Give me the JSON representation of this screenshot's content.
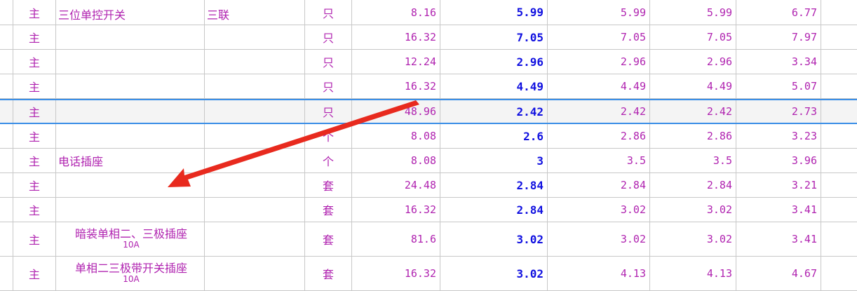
{
  "rows": [
    {
      "type": "主",
      "name": "三位单控开关",
      "name_sub": "",
      "spec": "三联",
      "unit": "只",
      "qty": "8.16",
      "price_bold": "5.99",
      "p2": "5.99",
      "p3": "5.99",
      "p4": "6.77"
    },
    {
      "type": "主",
      "name": "",
      "name_sub": "",
      "spec": "",
      "unit": "只",
      "qty": "16.32",
      "price_bold": "7.05",
      "p2": "7.05",
      "p3": "7.05",
      "p4": "7.97"
    },
    {
      "type": "主",
      "name": "",
      "name_sub": "",
      "spec": "",
      "unit": "只",
      "qty": "12.24",
      "price_bold": "2.96",
      "p2": "2.96",
      "p3": "2.96",
      "p4": "3.34"
    },
    {
      "type": "主",
      "name": "",
      "name_sub": "",
      "spec": "",
      "unit": "只",
      "qty": "16.32",
      "price_bold": "4.49",
      "p2": "4.49",
      "p3": "4.49",
      "p4": "5.07"
    },
    {
      "type": "主",
      "name": "",
      "name_sub": "",
      "spec": "",
      "unit": "只",
      "qty": "48.96",
      "price_bold": "2.42",
      "p2": "2.42",
      "p3": "2.42",
      "p4": "2.73"
    },
    {
      "type": "主",
      "name": "",
      "name_sub": "",
      "spec": "",
      "unit": "个",
      "qty": "8.08",
      "price_bold": "2.6",
      "p2": "2.86",
      "p3": "2.86",
      "p4": "3.23"
    },
    {
      "type": "主",
      "name": "电话插座",
      "name_sub": "",
      "spec": "",
      "unit": "个",
      "qty": "8.08",
      "price_bold": "3",
      "p2": "3.5",
      "p3": "3.5",
      "p4": "3.96"
    },
    {
      "type": "主",
      "name": "",
      "name_sub": "",
      "spec": "",
      "unit": "套",
      "qty": "24.48",
      "price_bold": "2.84",
      "p2": "2.84",
      "p3": "2.84",
      "p4": "3.21"
    },
    {
      "type": "主",
      "name": "",
      "name_sub": "",
      "spec": "",
      "unit": "套",
      "qty": "16.32",
      "price_bold": "2.84",
      "p2": "3.02",
      "p3": "3.02",
      "p4": "3.41"
    },
    {
      "type": "主",
      "name": "暗装单相二、三极插座",
      "name_sub": "10A",
      "spec": "",
      "unit": "套",
      "qty": "81.6",
      "price_bold": "3.02",
      "p2": "3.02",
      "p3": "3.02",
      "p4": "3.41"
    },
    {
      "type": "主",
      "name": "单相二三极带开关插座",
      "name_sub": "10A",
      "spec": "",
      "unit": "套",
      "qty": "16.32",
      "price_bold": "3.02",
      "p2": "4.13",
      "p3": "4.13",
      "p4": "4.67"
    }
  ],
  "selected_row": 4,
  "annotation": {
    "shape": "red-arrow",
    "color": "#e82a1e"
  }
}
